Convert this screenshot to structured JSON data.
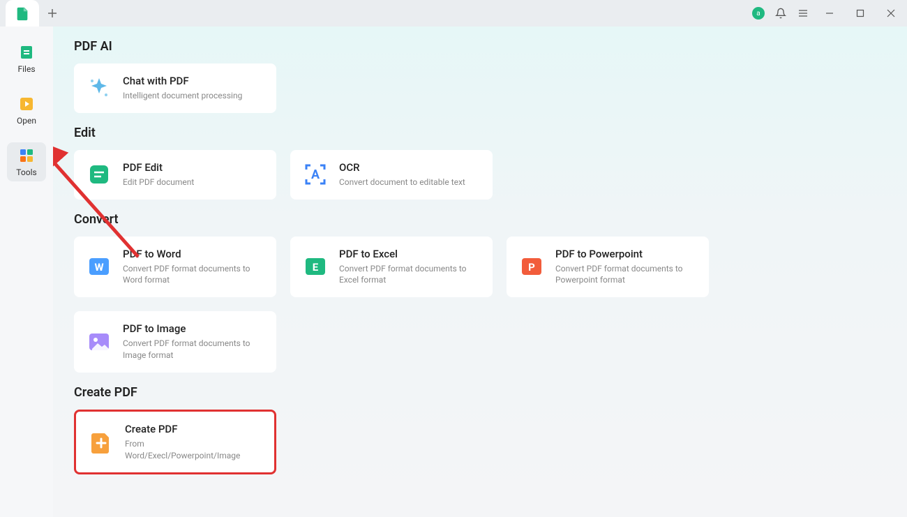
{
  "titlebar": {
    "avatar_letter": "a"
  },
  "sidebar": {
    "files": "Files",
    "open": "Open",
    "tools": "Tools"
  },
  "sections": {
    "pdf_ai": {
      "title": "PDF AI",
      "chat": {
        "title": "Chat with PDF",
        "desc": "Intelligent document processing"
      }
    },
    "edit": {
      "title": "Edit",
      "pdf_edit": {
        "title": "PDF Edit",
        "desc": "Edit PDF document"
      },
      "ocr": {
        "title": "OCR",
        "desc": "Convert document to editable text"
      }
    },
    "convert": {
      "title": "Convert",
      "to_word": {
        "title": "PDF to Word",
        "desc": "Convert PDF format documents to Word format"
      },
      "to_excel": {
        "title": "PDF to Excel",
        "desc": "Convert PDF format documents to Excel format"
      },
      "to_ppt": {
        "title": "PDF to Powerpoint",
        "desc": "Convert PDF format documents to Powerpoint format"
      },
      "to_image": {
        "title": "PDF to Image",
        "desc": "Convert PDF format documents to Image format"
      }
    },
    "create": {
      "title": "Create PDF",
      "create": {
        "title": "Create PDF",
        "desc": "From Word/Execl/Powerpoint/Image"
      }
    }
  }
}
